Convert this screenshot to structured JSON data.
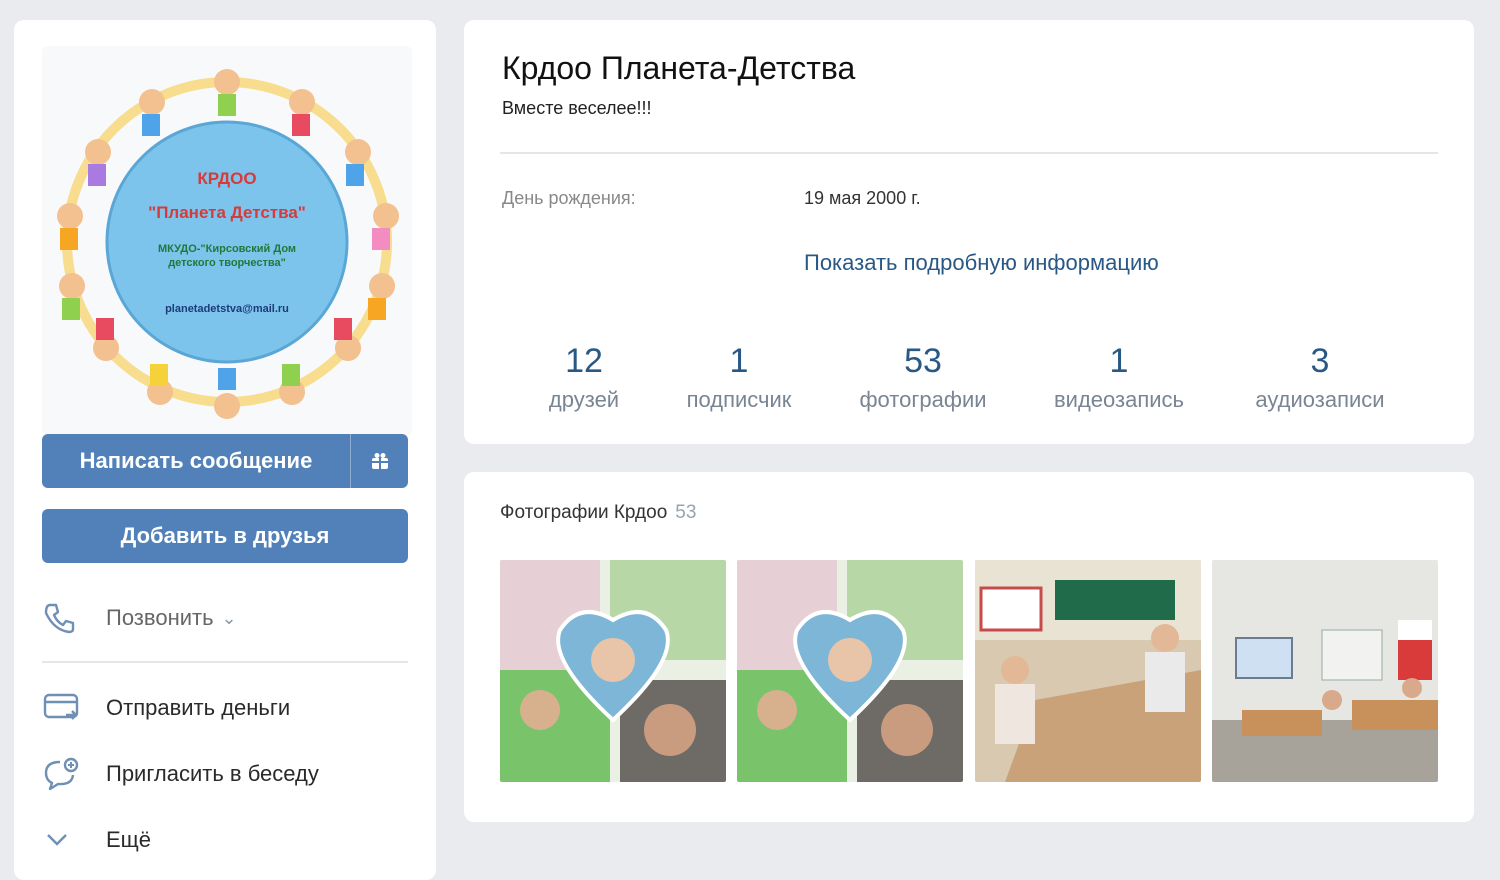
{
  "sidebar": {
    "avatar": {
      "text_top": "КРДОО",
      "text_name": "\"Планета Детства\"",
      "text_org": "МКУДО-\"Кирсовский Дом детского творчества\"",
      "text_email": "planetadetstva@mail.ru"
    },
    "message_button": "Написать сообщение",
    "add_friend_button": "Добавить в друзья",
    "call": "Позвонить",
    "send_money": "Отправить деньги",
    "invite_chat": "Пригласить в беседу",
    "more": "Ещё"
  },
  "profile": {
    "name": "Крдоо Планета-Детства",
    "status": "Вместе веселее!!!",
    "birthday_label": "День рождения:",
    "birthday_value": "19 мая 2000 г.",
    "show_more": "Показать подробную информацию",
    "counters": [
      {
        "num": "12",
        "label": "друзей"
      },
      {
        "num": "1",
        "label": "подписчик"
      },
      {
        "num": "53",
        "label": "фотографии"
      },
      {
        "num": "1",
        "label": "видеозапись"
      },
      {
        "num": "3",
        "label": "аудиозаписи"
      }
    ]
  },
  "photos": {
    "title": "Фотографии Крдоо",
    "count": "53"
  },
  "colors": {
    "accent": "#5181b8",
    "link": "#2a5885",
    "background": "#e9ebee"
  }
}
